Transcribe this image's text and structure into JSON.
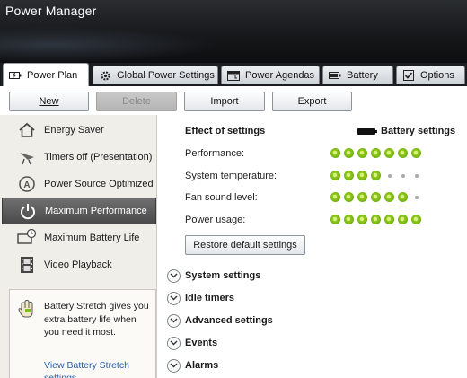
{
  "window": {
    "title": "Power Manager"
  },
  "tabs": [
    {
      "label": "Power Plan",
      "icon": "battery-bolt-icon",
      "active": true
    },
    {
      "label": "Global Power Settings",
      "icon": "gear-icon",
      "active": false
    },
    {
      "label": "Power Agendas",
      "icon": "calendar-icon",
      "active": false
    },
    {
      "label": "Battery",
      "icon": "battery-icon",
      "active": false
    },
    {
      "label": "Options",
      "icon": "checkbox-icon",
      "active": false
    }
  ],
  "toolbar": {
    "new_label": "New",
    "delete_label": "Delete",
    "import_label": "Import",
    "export_label": "Export"
  },
  "sidebar": {
    "plans": [
      {
        "label": "Energy Saver",
        "icon": "house-icon"
      },
      {
        "label": "Timers off (Presentation)",
        "icon": "presentation-icon"
      },
      {
        "label": "Power Source Optimized",
        "icon": "auto-power-icon"
      },
      {
        "label": "Maximum Performance",
        "icon": "power-icon",
        "selected": true
      },
      {
        "label": "Maximum Battery Life",
        "icon": "battery-clock-icon"
      },
      {
        "label": "Video Playback",
        "icon": "film-icon"
      }
    ],
    "stretch": {
      "text": "Battery Stretch gives you extra battery life when you need it most.",
      "link": "View Battery Stretch settings"
    }
  },
  "effect": {
    "title": "Effect of settings",
    "battery_title": "Battery settings",
    "metrics": [
      {
        "label": "Performance:",
        "level": 7,
        "max": 7
      },
      {
        "label": "System temperature:",
        "level": 4,
        "max": 7
      },
      {
        "label": "Fan sound level:",
        "level": 6,
        "max": 7
      },
      {
        "label": "Power usage:",
        "level": 7,
        "max": 7
      }
    ],
    "restore_label": "Restore default settings"
  },
  "sections": [
    {
      "label": "System settings"
    },
    {
      "label": "Idle timers"
    },
    {
      "label": "Advanced settings"
    },
    {
      "label": "Events"
    },
    {
      "label": "Alarms"
    }
  ],
  "colors": {
    "accent_green": "#8fcb1d",
    "selected_plan": "#555555",
    "link": "#2a5fa8",
    "titlebar": "#151719"
  }
}
